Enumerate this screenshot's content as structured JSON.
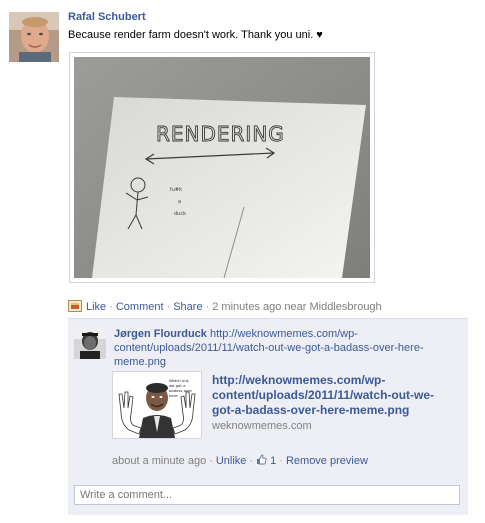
{
  "post": {
    "author": "Rafal Schubert",
    "message": "Because render farm doesn't work. Thank you uni. ♥",
    "photo": {
      "drawn_title": "RENDERING"
    },
    "actions": {
      "like": "Like",
      "comment": "Comment",
      "share": "Share",
      "separator": "·",
      "time": "2 minutes ago",
      "location_prefix": "near",
      "location": "Middlesbrough"
    }
  },
  "comments": [
    {
      "author": "Jørgen Flourduck",
      "link_text": "http://weknowmemes.com/wp-content/uploads/2011/11/watch-out-we-got-a-badass-over-here-meme.png",
      "share": {
        "title": "http://weknowmemes.com/wp-content/uploads/2011/11/watch-out-we-got-a-badass-over-here-meme.png",
        "domain": "weknowmemes.com",
        "thumb_text": "Watch out, we got a badass over here"
      },
      "meta": {
        "time": "about a minute ago",
        "unlike": "Unlike",
        "like_count": "1",
        "remove_preview": "Remove preview"
      }
    }
  ],
  "write_comment": {
    "placeholder": "Write a comment..."
  },
  "colors": {
    "link": "#3b5998",
    "ufi_background": "#edeff4",
    "muted": "#808080"
  },
  "icons": {
    "post_type": "photo-post-icon",
    "like": "thumbs-up-icon"
  }
}
